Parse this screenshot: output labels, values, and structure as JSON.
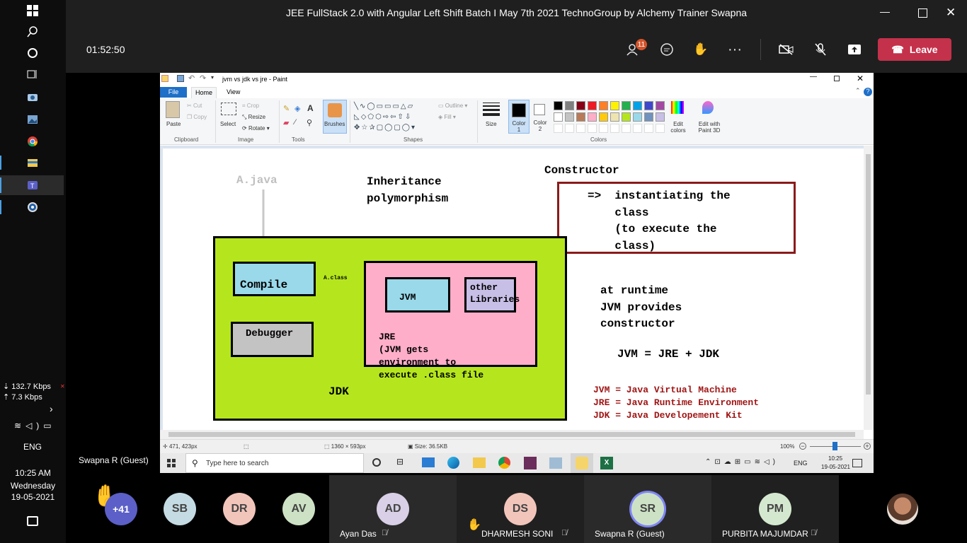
{
  "left_taskbar": {
    "net_down": "132.7 Kbps",
    "net_up": "7.3 Kbps",
    "lang": "ENG",
    "time": "10:25 AM",
    "day": "Wednesday",
    "date": "19-05-2021"
  },
  "teams": {
    "title": "JEE FullStack 2.0 with Angular Left Shift Batch I May 7th 2021 TechnoGroup by Alchemy Trainer Swapna",
    "timer": "01:52:50",
    "participants_badge": "11",
    "leave_label": "Leave",
    "presenter_name": "Swapna R (Guest)"
  },
  "paint": {
    "window_title": "jvm vs jdk vs jre - Paint",
    "tabs": [
      "File",
      "Home",
      "View"
    ],
    "clipboard": {
      "paste": "Paste",
      "cut": "Cut",
      "copy": "Copy",
      "label": "Clipboard"
    },
    "image": {
      "select": "Select",
      "crop": "Crop",
      "resize": "Resize",
      "rotate": "Rotate",
      "label": "Image"
    },
    "tools_label": "Tools",
    "brushes": "Brushes",
    "shapes": {
      "outline": "Outline",
      "fill": "Fill",
      "label": "Shapes"
    },
    "size": "Size",
    "color1": "Color 1",
    "color2": "Color 2",
    "colors_label": "Colors",
    "edit_colors": "Edit colors",
    "edit_paint3d": "Edit with Paint 3D",
    "palette": [
      "#000000",
      "#7f7f7f",
      "#880015",
      "#ed1c24",
      "#ff7f27",
      "#fff200",
      "#22b14c",
      "#00a2e8",
      "#3f48cc",
      "#a349a4",
      "#ffffff",
      "#c3c3c3",
      "#b97a57",
      "#ffaec9",
      "#ffc90e",
      "#efe4b0",
      "#b5e61d",
      "#99d9ea",
      "#7092be",
      "#c8bfe7"
    ],
    "status": {
      "cursor": "471, 423px",
      "dimensions": "1360 × 593px",
      "size": "Size: 36.5KB",
      "zoom": "100%"
    }
  },
  "drawing": {
    "a_java": "A.java",
    "inheritance": "Inheritance",
    "polymorphism": "polymorphism",
    "constructor": "Constructor",
    "ctor_lines": [
      "=>  instantiating the",
      "    class",
      "    (to execute the",
      "    class)"
    ],
    "compile": "Compile",
    "a_class": "A.class",
    "jvm": "JVM",
    "other_lib": [
      "other",
      "Libraries"
    ],
    "debugger": "Debugger",
    "jre_lines": [
      "JRE",
      "(JVM gets",
      "environment to",
      "execute .class file"
    ],
    "jdk": "JDK",
    "runtime_lines": [
      "at runtime",
      "JVM provides",
      "constructor"
    ],
    "equation": "JVM = JRE + JDK",
    "defs": [
      "JVM = Java Virtual Machine",
      "JRE = Java Runtime Environment",
      "JDK = Java Developement Kit"
    ]
  },
  "win_taskbar": {
    "search_placeholder": "Type here to search",
    "lang": "ENG",
    "time": "10:25",
    "date": "19-05-2021"
  },
  "participants": [
    {
      "initials": "+41",
      "name": ""
    },
    {
      "initials": "SB",
      "name": ""
    },
    {
      "initials": "DR",
      "name": ""
    },
    {
      "initials": "AV",
      "name": ""
    },
    {
      "initials": "AD",
      "name": "Ayan Das"
    },
    {
      "initials": "DS",
      "name": "DHARMESH SONI"
    },
    {
      "initials": "SR",
      "name": "Swapna R (Guest)"
    },
    {
      "initials": "PM",
      "name": "PURBITA MAJUMDAR"
    }
  ]
}
